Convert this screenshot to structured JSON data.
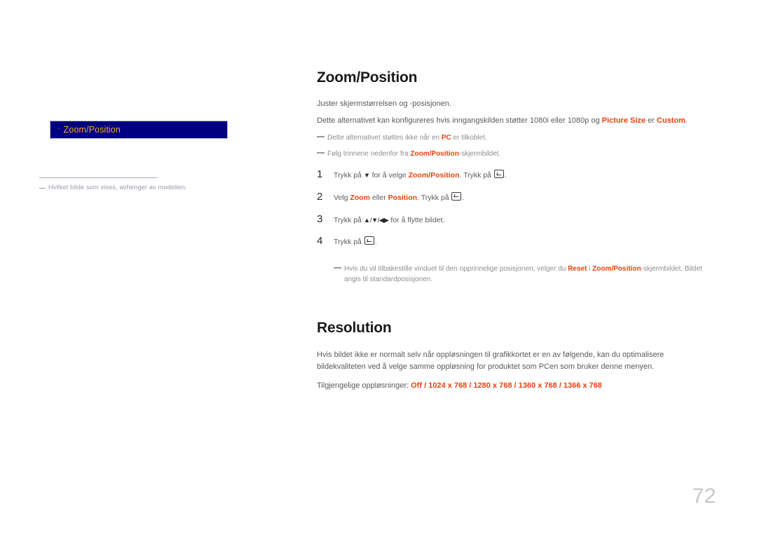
{
  "colors": {
    "accent": "#e8420f",
    "menu_bg": "#000080",
    "menu_label": "#f5a623",
    "body_text": "#5a5a5c",
    "note_text": "#8e8e92",
    "page_number": "#c8c8c8"
  },
  "left_panel": {
    "menu_item": {
      "bullet": "·",
      "label": "Zoom/Position"
    },
    "note": "Hvilket bilde som vises, avhenger av modellen."
  },
  "zoom_section": {
    "title": "Zoom/Position",
    "desc_1": "Juster skjermstørrelsen og -posisjonen.",
    "desc_2_parts": {
      "a": "Dette alternativet kan konfigureres hvis inngangskilden støtter 1080i eller 1080p og ",
      "b": "Picture Size",
      "c": " er ",
      "d": "Custom",
      "e": "."
    },
    "note_1_parts": {
      "a": "Dette alternativet støttes ikke når en ",
      "b": "PC",
      "c": " er tilkoblet."
    },
    "note_2_parts": {
      "a": "Følg trinnene nedenfor fra ",
      "b": "Zoom/Position",
      "c": "-skjermbildet."
    },
    "steps": [
      {
        "num": "1",
        "parts": {
          "a": "Trykk på ",
          "arrows": "▼",
          "b": " for å velge ",
          "c": "Zoom/Position",
          "d": ". Trykk på ",
          "e": "."
        }
      },
      {
        "num": "2",
        "parts": {
          "a": "Velg ",
          "c": "Zoom",
          "b": " eller ",
          "d": "Position",
          "e": ". Trykk på ",
          "f": "."
        }
      },
      {
        "num": "3",
        "parts": {
          "a": "Trykk på ",
          "arrows": "▲/▼/◀▶",
          "b": " for å flytte bildet."
        }
      },
      {
        "num": "4",
        "parts": {
          "a": "Trykk på ",
          "e": "."
        }
      }
    ],
    "final_note_parts": {
      "a": "Hvis du vil tilbakestille vinduet til den opprinnelige posisjonen, velger du ",
      "b": "Reset",
      "c": " i ",
      "d": "Zoom/Position",
      "e": "-skjermbildet. Bildet angis til standardposisjonen."
    }
  },
  "resolution_section": {
    "title": "Resolution",
    "desc": "Hvis bildet ikke er normalt selv når oppløsningen til grafikkortet er en av følgende, kan du optimalisere bildekvaliteten ved å velge samme oppløsning for produktet som PCen som bruker denne menyen.",
    "list_label": "Tilgjengelige oppløsninger: ",
    "list_values": "Off / 1024 x 768 / 1280 x 768 / 1360 x 768 / 1366 x 768"
  },
  "page_number": "72"
}
